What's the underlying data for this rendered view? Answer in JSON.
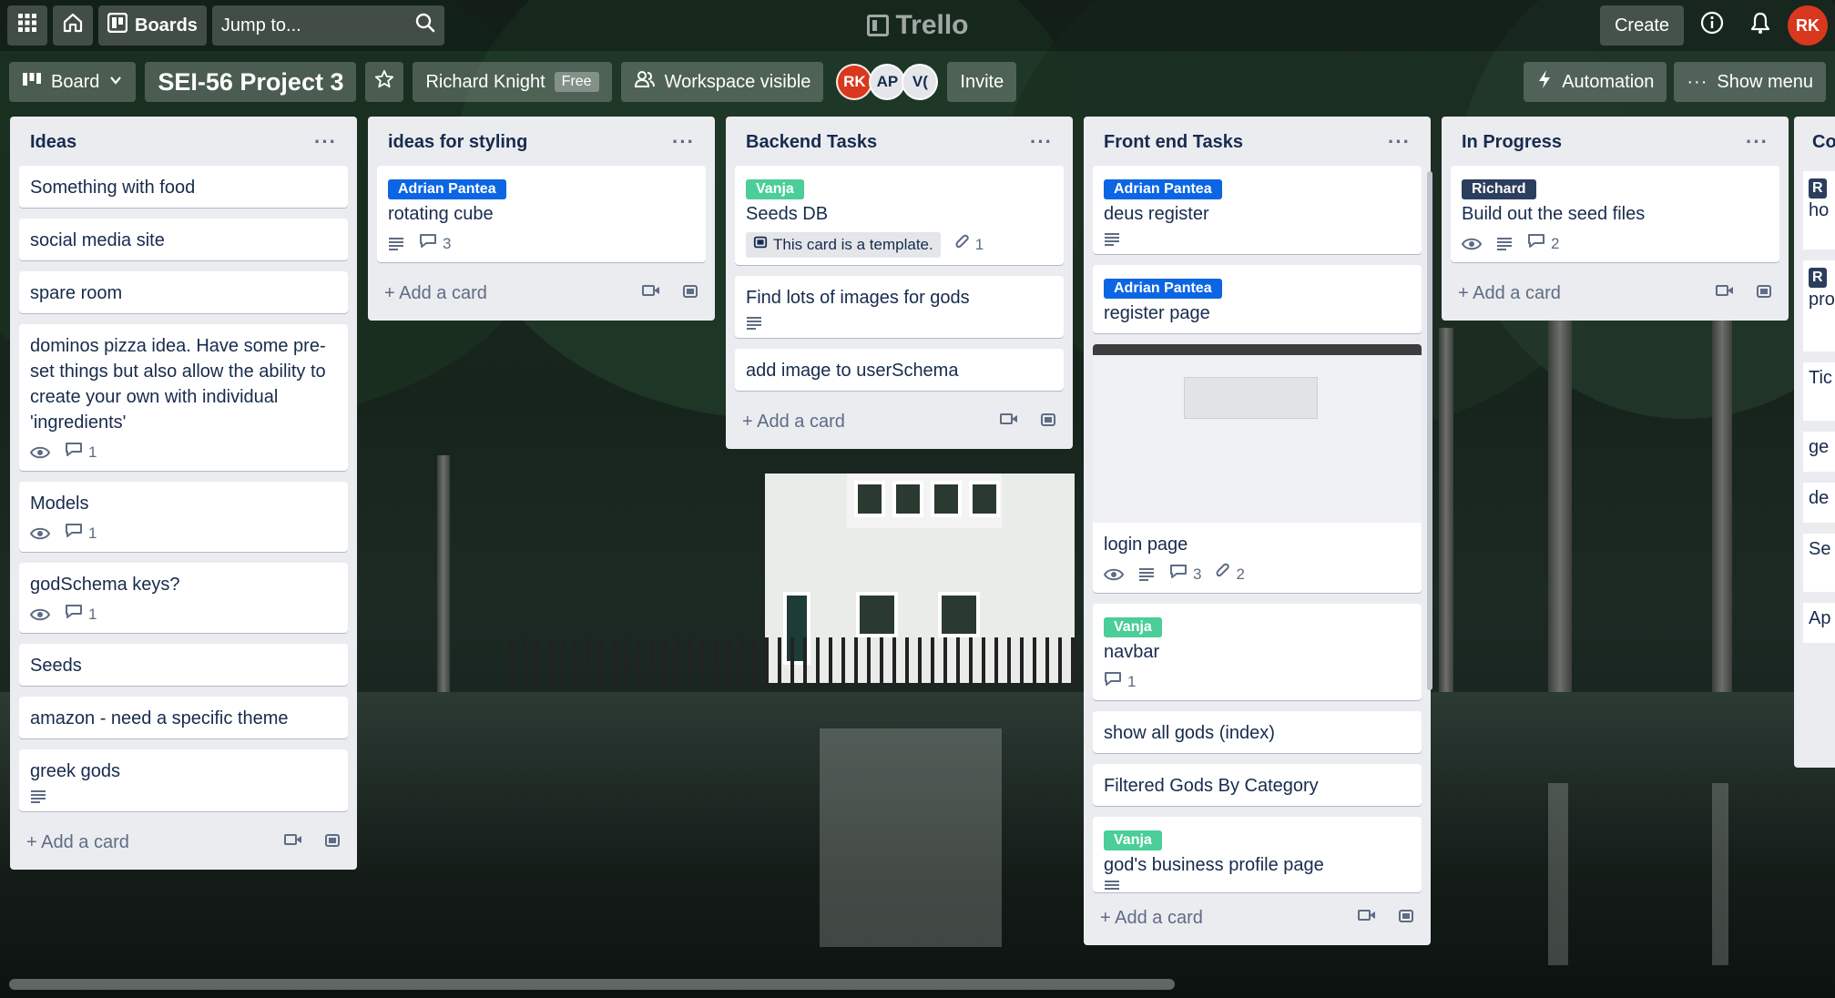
{
  "topbar": {
    "boards_label": "Boards",
    "search_placeholder": "Jump to...",
    "logo_text": "Trello",
    "create_label": "Create",
    "user_initials": "RK"
  },
  "boardbar": {
    "view_label": "Board",
    "board_title": "SEI-56 Project 3",
    "workspace_name": "Richard Knight",
    "plan_badge": "Free",
    "visibility_label": "Workspace visible",
    "members": [
      {
        "initials": "RK",
        "color": "#d9381e"
      },
      {
        "initials": "AP",
        "color": "#0c66e4"
      },
      {
        "initials": "V(",
        "color": "#1f845a"
      }
    ],
    "invite_label": "Invite",
    "automation_label": "Automation",
    "show_menu_label": "Show menu"
  },
  "add_card_label": "Add a card",
  "label_colors": {
    "blue": "#0c66e4",
    "green": "#4bce97",
    "navy": "#2c3e5d"
  },
  "lists": [
    {
      "title": "Ideas",
      "cards": [
        {
          "title": "Something with food"
        },
        {
          "title": "social media site"
        },
        {
          "title": "spare room"
        },
        {
          "title": "dominos pizza idea. Have some pre-set things but also allow the ability to create your own with individual 'ingredients'",
          "comments": "1"
        },
        {
          "title": "Models",
          "comments": "1"
        },
        {
          "title": "godSchema keys?",
          "comments": "1"
        },
        {
          "title": "Seeds"
        },
        {
          "title": "amazon - need a specific theme"
        },
        {
          "title": "greek gods"
        }
      ]
    },
    {
      "title": "ideas for styling",
      "cards": [
        {
          "label": "Adrian Pantea",
          "title": "rotating cube",
          "comments": "3"
        }
      ]
    },
    {
      "title": "Backend Tasks",
      "cards": [
        {
          "label": "Vanja",
          "title": "Seeds DB",
          "template_text": "This card is a template.",
          "attachments": "1"
        },
        {
          "title": "Find lots of images for gods"
        },
        {
          "title": "add image to userSchema"
        }
      ]
    },
    {
      "title": "Front end Tasks",
      "cards": [
        {
          "label": "Adrian Pantea",
          "title": "deus register"
        },
        {
          "label": "Adrian Pantea",
          "title": "register page"
        },
        {
          "title": "login page",
          "comments": "3",
          "attachments": "2"
        },
        {
          "label": "Vanja",
          "title": "navbar",
          "comments": "1"
        },
        {
          "title": "show all gods (index)"
        },
        {
          "title": "Filtered Gods By Category"
        },
        {
          "label": "Vanja",
          "title": "god's business profile page"
        }
      ]
    },
    {
      "title": "In Progress",
      "cards": [
        {
          "label": "Richard",
          "title": "Build out the seed files",
          "comments": "2"
        }
      ]
    }
  ],
  "partial_list": {
    "title_fragment": "Co",
    "card_fragments": [
      "R",
      "ho",
      "R",
      "pro",
      "Tic",
      "ge",
      "de",
      "Se",
      "Ap"
    ]
  }
}
